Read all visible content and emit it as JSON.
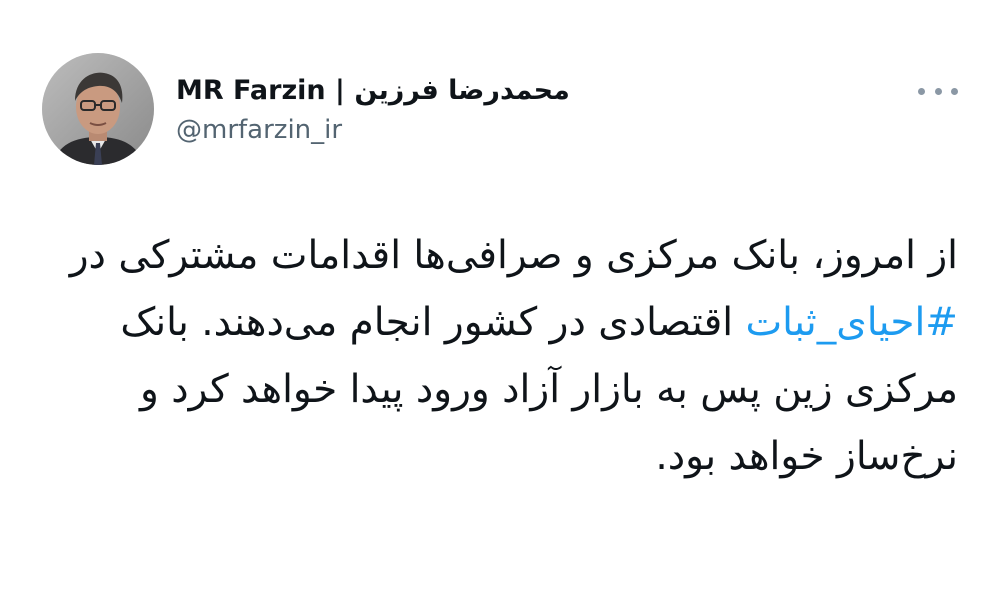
{
  "author": {
    "display_name": "محمدرضا فرزین | MR Farzin",
    "handle": "@mrfarzin_ir"
  },
  "tweet": {
    "text_before": "از امروز، بانک مرکزی و صرافی‌ها اقدامات مشترکی در ",
    "hashtag": "#احیای_ثبات",
    "text_after": " اقتصادی در کشور انجام می‌دهند. بانک مرکزی زین پس به بازار آزاد ورود پیدا خواهد کرد و نرخ‌ساز خواهد بود."
  },
  "colors": {
    "hashtag": "#1d9bf0",
    "handle": "#536471",
    "text": "#0f1419"
  },
  "icons": {
    "more": "more-horizontal-icon"
  }
}
